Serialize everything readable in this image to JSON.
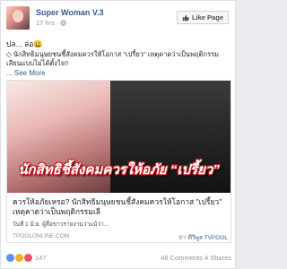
{
  "post": {
    "page_name": "Super Woman V.3",
    "time": "17 hrs",
    "like_page_label": "Like Page",
    "text_line1": "ปล... ล่อ😀",
    "text_line2": "◇ นักสิทธิมนุษยชนชี้สังคมควรให้โอกาส \"เปรี้ยว\" เหตุคาดว่าเป็นพฤติกรรมเลียนแบบไม่ได้ตั้งใจ!!",
    "see_more": "... See More"
  },
  "preview": {
    "image_title": "นักสิทธิชี้สังคมควรให้อภัย “เปรี้ยว”",
    "title": "ควรให้อภัยเหรอ? นักสิทธิมนุษยชนชี้สังคมควรให้โอกาส \"เปรี้ยว\" เหตุคาดว่าเป็นพฤติกรรมเลี",
    "description": "วันที่ 1 มิ.ย. ผู้สื่อข่าวรายงานว่าแม้ว่า...",
    "domain": "TPOOLONLINE.COM",
    "by_prefix": "BY",
    "by_author": "ทีวีพูล TVPOOL"
  },
  "reactions": {
    "count": "147",
    "comments": "48 Comments",
    "shares": "4 Shares",
    "icons": [
      "like-icon",
      "wow-icon",
      "love-icon"
    ]
  },
  "colors": {
    "link": "#365899",
    "meta": "#90949c",
    "text": "#1d2129",
    "border": "#dddfe2",
    "overlay_outline": "#c21c1c"
  }
}
